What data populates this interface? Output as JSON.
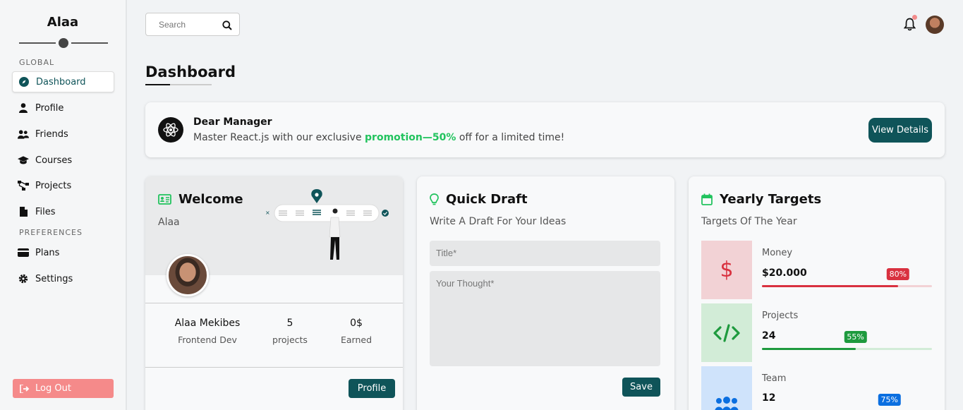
{
  "sidebar": {
    "brand": "Alaa",
    "global_label": "GLOBAL",
    "preferences_label": "PREFERENCES",
    "items": [
      {
        "label": "Dashboard",
        "icon": "compass-icon",
        "active": true
      },
      {
        "label": "Profile",
        "icon": "user-icon"
      },
      {
        "label": "Friends",
        "icon": "users-icon"
      },
      {
        "label": "Courses",
        "icon": "graduation-cap-icon"
      },
      {
        "label": "Projects",
        "icon": "diagram-icon"
      },
      {
        "label": "Files",
        "icon": "file-icon"
      },
      {
        "label": "Plans",
        "icon": "credit-card-icon"
      },
      {
        "label": "Settings",
        "icon": "gear-icon"
      }
    ],
    "logout_label": "Log Out"
  },
  "search": {
    "placeholder": "Search"
  },
  "page": {
    "title": "Dashboard"
  },
  "promo": {
    "title": "Dear Manager",
    "text_before": "Master React.js with our exclusive",
    "highlight": "promotion—50%",
    "text_after": "off for a limited time!",
    "button_label": "View Details"
  },
  "welcome": {
    "title": "Welcome",
    "subtitle": "Alaa",
    "stats": [
      {
        "value": "Alaa Mekibes",
        "label": "Frontend Dev"
      },
      {
        "value": "5",
        "label": "projects"
      },
      {
        "value": "0$",
        "label": "Earned"
      }
    ],
    "button_label": "Profile"
  },
  "draft": {
    "title": "Quick Draft",
    "subtitle": "Write A Draft For Your Ideas",
    "title_placeholder": "Title*",
    "body_placeholder": "Your Thought*",
    "button_label": "Save"
  },
  "targets": {
    "title": "Yearly Targets",
    "subtitle": "Targets Of The Year",
    "rows": [
      {
        "name": "Money",
        "value": "$20.000",
        "percent_label": "80%",
        "percent": 80,
        "color": "#d9313f",
        "bg": "#f2d2d5",
        "icon": "dollar-icon"
      },
      {
        "name": "Projects",
        "value": "24",
        "percent_label": "55%",
        "percent": 55,
        "color": "#1e9a3e",
        "bg": "#d2ecd7",
        "icon": "code-icon"
      },
      {
        "name": "Team",
        "value": "12",
        "percent_label": "75%",
        "percent": 75,
        "color": "#0b6fe0",
        "bg": "#cfe3fb",
        "icon": "team-icon"
      }
    ]
  },
  "colors": {
    "accent": "#0f5459",
    "highlight": "#22c35e",
    "logout": "#f58a8a"
  }
}
